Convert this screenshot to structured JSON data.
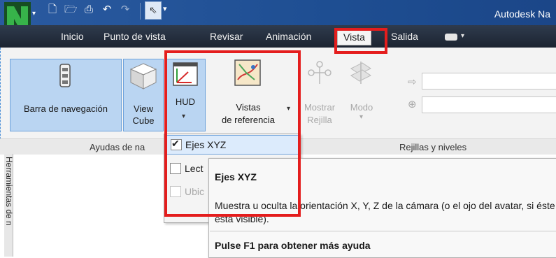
{
  "app": {
    "title": "Autodesk Na"
  },
  "tabs": [
    {
      "label": "Inicio"
    },
    {
      "label": "Punto de vista"
    },
    {
      "label": "Revisar"
    },
    {
      "label": "Animación"
    },
    {
      "label": "Vista"
    },
    {
      "label": "Salida"
    }
  ],
  "ribbon": {
    "buttons": [
      {
        "label": "Barra de navegación"
      },
      {
        "label_line1": "View",
        "label_line2": "Cube"
      },
      {
        "label": "HUD"
      },
      {
        "label_line1": "Vistas",
        "label_line2": "de referencia"
      },
      {
        "label_line1": "Mostrar",
        "label_line2": "Rejilla"
      },
      {
        "label": "Modo"
      }
    ],
    "groups": [
      {
        "label": "Ayudas de na"
      },
      {
        "label": "Rejillas y niveles"
      }
    ]
  },
  "left_panel": {
    "label": "Herramientas de n"
  },
  "menu": {
    "items": [
      {
        "label": "Ejes XYZ",
        "checked": true
      },
      {
        "label": "Lect",
        "checked": false
      },
      {
        "label": "Ubic",
        "checked": false,
        "disabled": true
      }
    ]
  },
  "tooltip": {
    "title": "Ejes XYZ",
    "description": "Muestra u oculta la orientación X, Y, Z de la cámara (o el ojo del avatar, si éste está visible).",
    "help": "Pulse F1 para obtener más ayuda"
  },
  "colors": {
    "highlight_box": "#e41d1d",
    "selected_button": "#bad5f2",
    "title_bar": "#1f4d8f"
  }
}
